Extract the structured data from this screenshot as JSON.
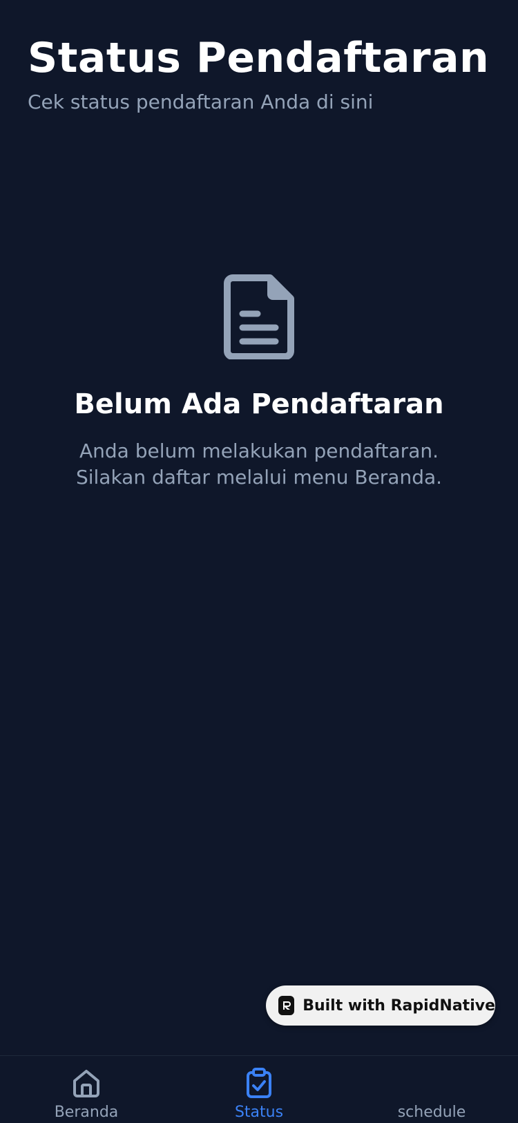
{
  "header": {
    "title": "Status Pendaftaran",
    "subtitle": "Cek status pendaftaran Anda di sini"
  },
  "empty_state": {
    "icon": "document-icon",
    "title": "Belum Ada Pendaftaran",
    "description": "Anda belum melakukan pendaftaran. Silakan daftar melalui menu Beranda."
  },
  "badge": {
    "label": "Built with RapidNative"
  },
  "tabs": [
    {
      "label": "Beranda",
      "icon": "home-icon",
      "active": false
    },
    {
      "label": "Status",
      "icon": "clipboard-check-icon",
      "active": true
    },
    {
      "label": "schedule",
      "icon": "",
      "active": false
    }
  ],
  "colors": {
    "background": "#0f172a",
    "muted_text": "#94a3b8",
    "accent": "#3b82f6",
    "badge_bg": "#f1f1f1"
  }
}
